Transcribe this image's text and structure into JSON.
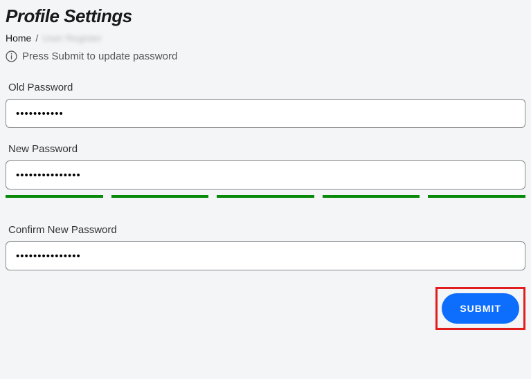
{
  "page": {
    "title": "Profile Settings"
  },
  "breadcrumb": {
    "home": "Home",
    "separator": "/",
    "current": "User Register"
  },
  "info": {
    "message": "Press Submit to update password"
  },
  "form": {
    "old_password": {
      "label": "Old Password",
      "value": "•••••••••••"
    },
    "new_password": {
      "label": "New Password",
      "value": "•••••••••••••••"
    },
    "confirm_password": {
      "label": "Confirm New Password",
      "value": "•••••••••••••••"
    },
    "strength_color": "#0a8a0a"
  },
  "buttons": {
    "submit": "SUBMIT"
  }
}
